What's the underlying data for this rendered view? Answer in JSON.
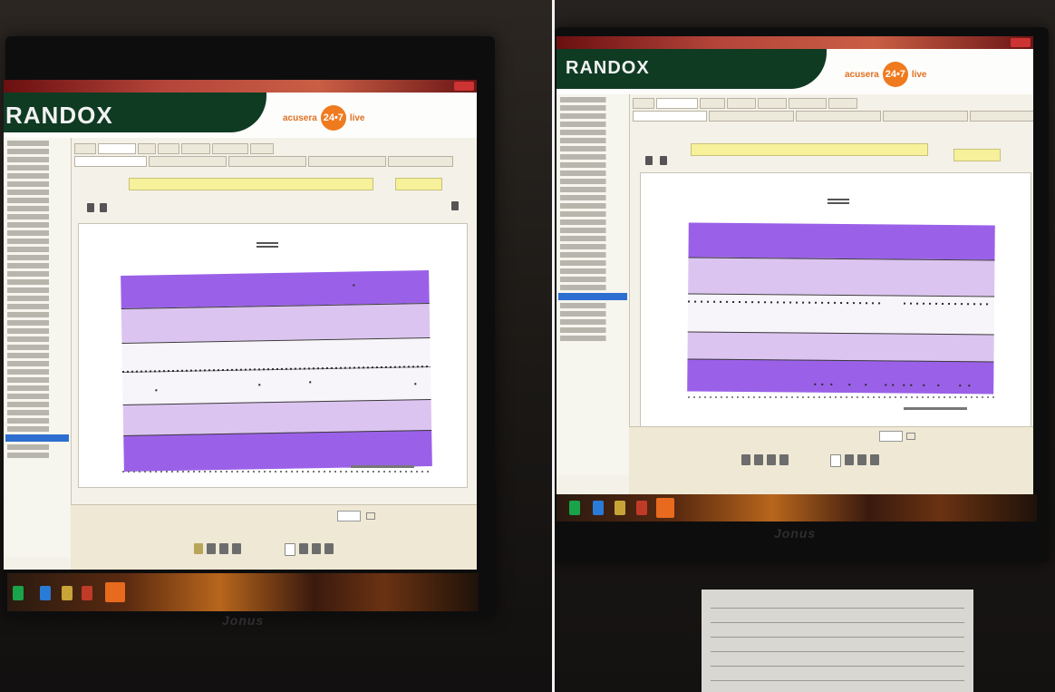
{
  "brand": {
    "logo": "RANDOX",
    "product": "acusera",
    "product_badge": "24•7",
    "product_suffix": "live"
  },
  "monitor": {
    "bezel_brand": "Jonus"
  },
  "colors": {
    "header_green": "#0f3b23",
    "band_dark": "#9a61e8",
    "band_mid": "#dcc4f0",
    "band_light": "#f7f4fa",
    "field_yellow": "#f6f19a",
    "accent_orange": "#f07a1e"
  },
  "icons": [
    "monitor",
    "taskbar",
    "printer-icon",
    "search-icon",
    "folder-icon",
    "document-icon"
  ]
}
